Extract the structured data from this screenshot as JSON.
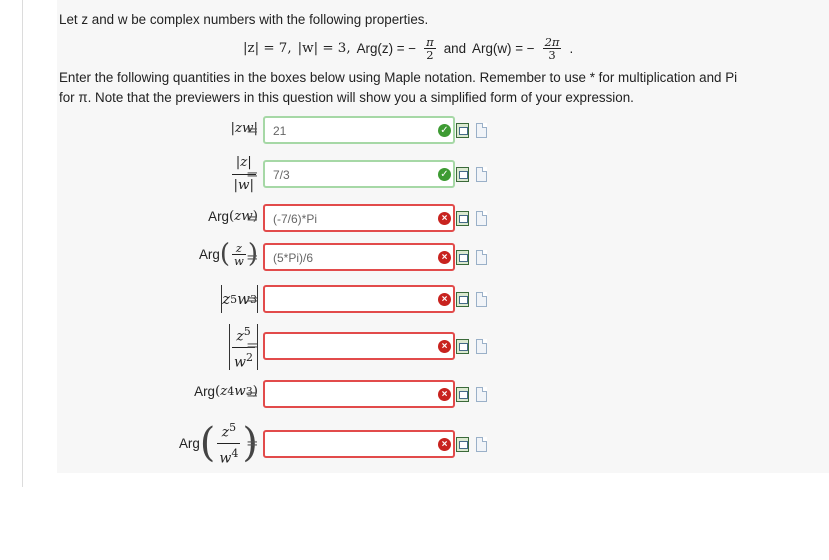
{
  "intro": {
    "line1": "Let z and w be complex numbers with the following properties.",
    "props": {
      "z_mod": "|z| = 7,",
      "w_mod": "|w| = 3,",
      "argz_prefix": "Arg(z) = −",
      "argz_num": "π",
      "argz_den": "2",
      "and_text": "and",
      "argw_prefix": "Arg(w) = −",
      "argw_num": "2π",
      "argw_den": "3",
      "period": "."
    },
    "instructions_line1": "Enter the following quantities in the boxes below using Maple notation.  Remember to use * for multiplication and Pi",
    "instructions_line2": "for π. Note that the previewers in this question will show you a simplified form of your expression."
  },
  "rows": [
    {
      "label": "|zw|",
      "answer": "21",
      "status": "correct"
    },
    {
      "label": "|z| / |w|",
      "answer": "7/3",
      "status": "correct"
    },
    {
      "label": "Arg(zw)",
      "answer": "(-7/6)*Pi",
      "status": "incorrect"
    },
    {
      "label": "Arg(z/w)",
      "answer": "(5*Pi)/6",
      "status": "incorrect"
    },
    {
      "label": "|z^5 w^3|",
      "answer": "",
      "status": "incorrect"
    },
    {
      "label": "|z^5 / w^2|",
      "answer": "",
      "status": "incorrect"
    },
    {
      "label": "Arg(z^4 w^3)",
      "answer": "",
      "status": "incorrect"
    },
    {
      "label": "Arg(z^5 / w^4)",
      "answer": "",
      "status": "incorrect"
    }
  ],
  "labels": {
    "arg": "Arg",
    "z": "z",
    "w": "w",
    "zw": "zw",
    "exp5": "5",
    "exp3": "3",
    "exp2": "2",
    "exp4": "4",
    "equals": "="
  },
  "icons": {
    "correct": "check-circle-icon",
    "incorrect": "x-circle-icon",
    "preview": "equation-preview-icon",
    "help": "document-help-icon"
  },
  "colors": {
    "correct_border": "#a6d8a6",
    "incorrect_border": "#e24b4b",
    "correct_mark": "#3e9b33",
    "incorrect_mark": "#c8231f"
  }
}
